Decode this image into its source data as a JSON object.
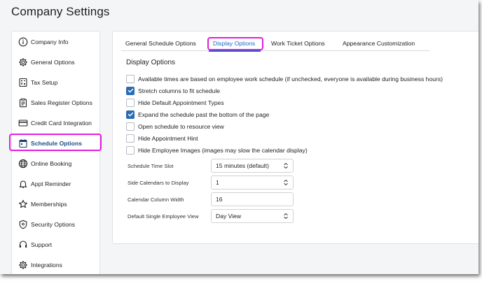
{
  "page": {
    "title": "Company Settings"
  },
  "sidebar": {
    "items": [
      {
        "label": "Company Info",
        "icon": "info-icon"
      },
      {
        "label": "General Options",
        "icon": "gear-icon"
      },
      {
        "label": "Tax Setup",
        "icon": "calculator-icon"
      },
      {
        "label": "Sales Register Options",
        "icon": "clipboard-icon"
      },
      {
        "label": "Credit Card Integration",
        "icon": "credit-card-icon"
      },
      {
        "label": "Schedule Options",
        "icon": "calendar-icon",
        "active": true
      },
      {
        "label": "Online Booking",
        "icon": "globe-icon"
      },
      {
        "label": "Appt Reminder",
        "icon": "bell-icon"
      },
      {
        "label": "Memberships",
        "icon": "star-icon"
      },
      {
        "label": "Security Options",
        "icon": "shield-icon"
      },
      {
        "label": "Support",
        "icon": "headset-icon"
      },
      {
        "label": "Integrations",
        "icon": "gear-icon"
      }
    ]
  },
  "tabs": [
    {
      "label": "General Schedule Options"
    },
    {
      "label": "Display Options",
      "active": true
    },
    {
      "label": "Work Ticket Options"
    },
    {
      "label": "Appearance Customization"
    }
  ],
  "display_options": {
    "title": "Display Options",
    "checkboxes": [
      {
        "label": "Available times are based on employee work schedule (if unchecked, everyone is available during business hours)",
        "checked": false
      },
      {
        "label": "Stretch columns to fit schedule",
        "checked": true
      },
      {
        "label": "Hide Default Appointment Types",
        "checked": false
      },
      {
        "label": "Expand the schedule past the bottom of the page",
        "checked": true
      },
      {
        "label": "Open schedule to resource view",
        "checked": false
      },
      {
        "label": "Hide Appointment Hint",
        "checked": false
      },
      {
        "label": "Hide Employee Images (images may slow the calendar display)",
        "checked": false
      }
    ],
    "fields": [
      {
        "label": "Schedule Time Slot",
        "value": "15 minutes (default)",
        "type": "select"
      },
      {
        "label": "Side Calendars to Display",
        "value": "1",
        "type": "select"
      },
      {
        "label": "Calendar Column Width",
        "value": "16",
        "type": "input"
      },
      {
        "label": "Default Single Employee View",
        "value": "Day View",
        "type": "select"
      }
    ]
  },
  "colors": {
    "accent": "#1a66c7",
    "checkbox_checked": "#2a6db5",
    "highlight": "#e01ee0"
  }
}
